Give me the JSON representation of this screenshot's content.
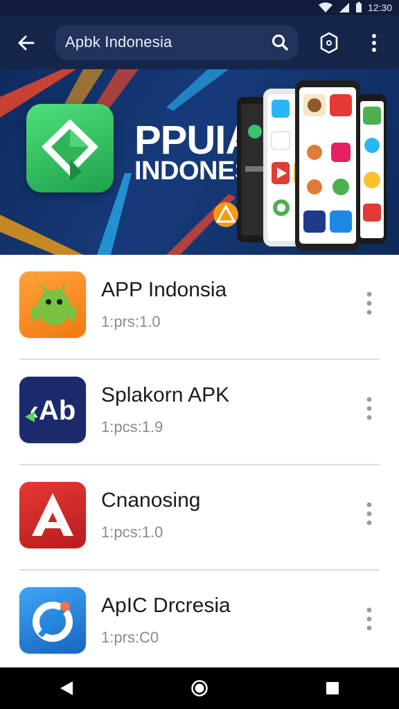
{
  "status_bar": {
    "time": "12:30"
  },
  "search": {
    "query": "Apbk Indonesia"
  },
  "banner": {
    "title_line1": "PPUIA",
    "title_line2": "INDONESIA"
  },
  "apps": [
    {
      "name": "APP Indonsia",
      "meta": "1:prs:1.0",
      "icon": "android-icon",
      "icon_color": "#f08a1c"
    },
    {
      "name": "Splakorn APK",
      "meta": "1:pcs:1.9",
      "icon": "apk-logo-icon",
      "icon_color": "#1a2a6c"
    },
    {
      "name": "Cnanosing",
      "meta": "1:pcs:1.0",
      "icon": "a-logo-icon",
      "icon_color": "#d0211f"
    },
    {
      "name": "ApIC Drcresia",
      "meta": "1:prs:C0",
      "icon": "swirl-logo-icon",
      "icon_color": "#1e88e5"
    }
  ],
  "colors": {
    "app_bar": "#16264a",
    "banner_bg": "#163a7a",
    "nav_bar": "#000000"
  }
}
